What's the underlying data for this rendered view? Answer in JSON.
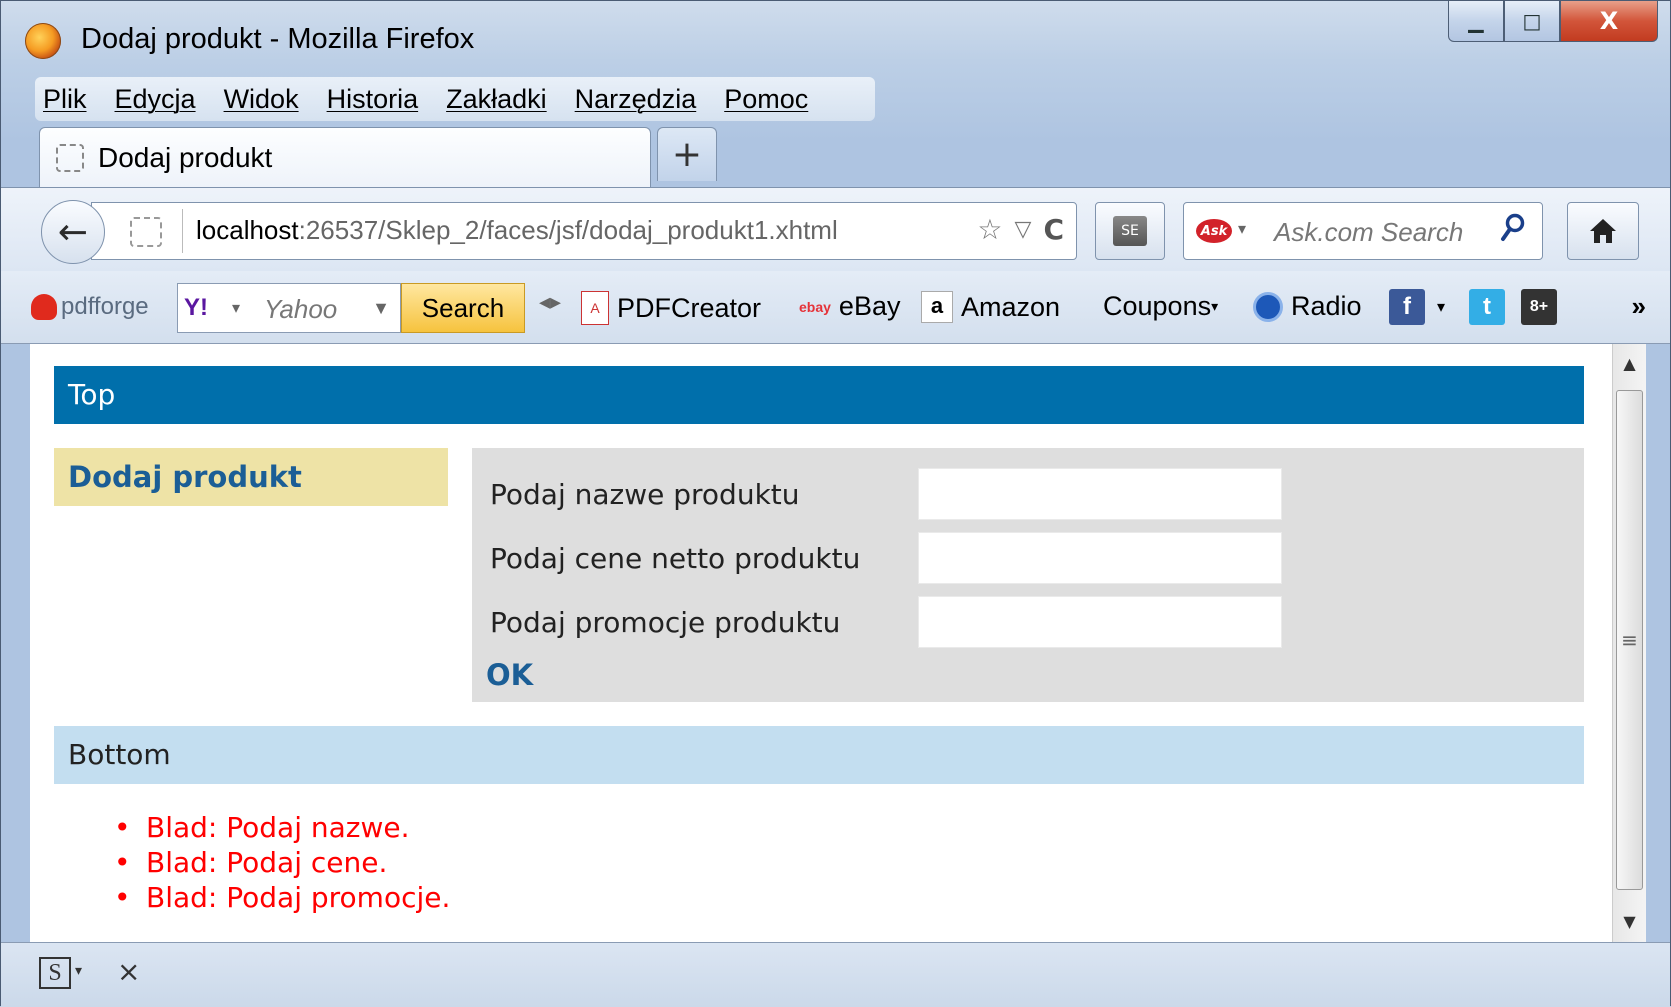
{
  "window": {
    "title": "Dodaj produkt - Mozilla Firefox",
    "controls": {
      "minimize": "▁",
      "maximize": "□",
      "close": "X"
    }
  },
  "menubar": {
    "items": [
      "Plik",
      "Edycja",
      "Widok",
      "Historia",
      "Zakładki",
      "Narzędzia",
      "Pomoc"
    ]
  },
  "tabs": [
    {
      "label": "Dodaj produkt",
      "active": true
    }
  ],
  "newtab_label": "+",
  "navbar": {
    "back": "←",
    "url_host": "localhost",
    "url_rest": ":26537/Sklep_2/faces/jsf/dodaj_produkt1.xhtml",
    "bookmark_star": "☆",
    "dropdown": "▽",
    "reload": "C",
    "search_engine_logo": "Ask",
    "search_placeholder": "Ask.com Search",
    "search_icon": "⚲",
    "home": "⌂"
  },
  "toolbar": {
    "pdfforge": "pdfforge",
    "yahoo_logo": "Y!",
    "yahoo_placeholder": "Yahoo",
    "search_button": "Search",
    "bookmarks": [
      {
        "label": "PDFCreator",
        "icon": "pdf-icon"
      },
      {
        "label": "eBay",
        "icon": "ebay-icon"
      },
      {
        "label": "Amazon",
        "icon": "amazon-icon"
      },
      {
        "label": "Coupons",
        "icon": "coupons-dropdown"
      },
      {
        "label": "Radio",
        "icon": "radio-icon"
      }
    ],
    "facebook": "f",
    "twitter": "t",
    "googleplus": "8+",
    "overflow": "»"
  },
  "page": {
    "top": "Top",
    "left_link": "Dodaj produkt",
    "form": {
      "fields": [
        {
          "label": "Podaj nazwe produktu",
          "value": ""
        },
        {
          "label": "Podaj cene netto produktu",
          "value": ""
        },
        {
          "label": "Podaj promocje produktu",
          "value": ""
        }
      ],
      "submit": "OK"
    },
    "bottom": "Bottom",
    "errors": [
      "Blad: Podaj nazwe.",
      "Blad: Podaj cene.",
      "Blad: Podaj promocje."
    ]
  },
  "statusbar": {
    "addon_icon": "S",
    "close": "×"
  },
  "colors": {
    "top_band": "#006fab",
    "left_menu": "#eee3a6",
    "form_bg": "#dedede",
    "bottom_band": "#c3def0",
    "link": "#1b5e96",
    "error": "#ff0000"
  }
}
